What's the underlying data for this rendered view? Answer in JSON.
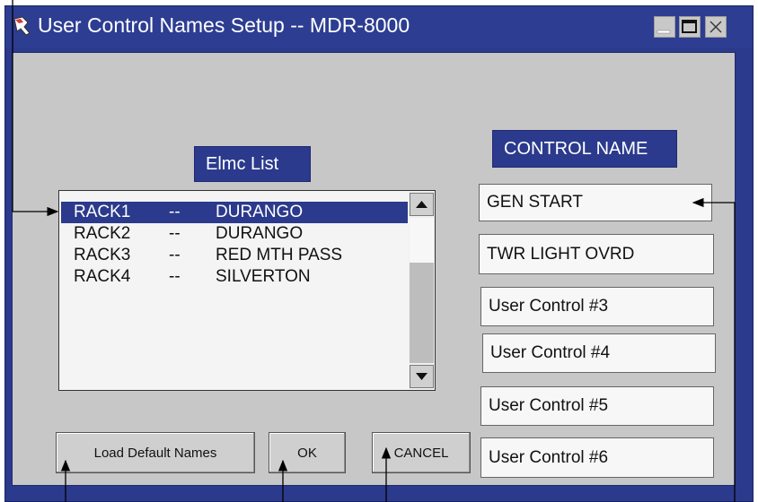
{
  "window": {
    "title": "User Control Names Setup  --  MDR-8000",
    "app_icon": "app-icon",
    "buttons": [
      "minimize-icon",
      "maximize-icon",
      "close-icon"
    ]
  },
  "labels": {
    "elmc_list": "Elmc List",
    "control_name": "CONTROL NAME"
  },
  "list": {
    "rows": [
      {
        "rack": "RACK1",
        "sep": "--",
        "site": "DURANGO",
        "selected": true
      },
      {
        "rack": "RACK2",
        "sep": "--",
        "site": "DURANGO",
        "selected": false
      },
      {
        "rack": "RACK3",
        "sep": "--",
        "site": "RED MTH PASS",
        "selected": false
      },
      {
        "rack": "RACK4",
        "sep": "--",
        "site": "SILVERTON",
        "selected": false
      }
    ]
  },
  "controls": [
    "GEN START",
    "TWR LIGHT OVRD",
    "User Control #3",
    "User Control #4",
    "User Control #5",
    "User Control #6"
  ],
  "buttons": {
    "load_defaults": "Load Default Names",
    "ok": "OK",
    "cancel": "CANCEL"
  },
  "colors": {
    "window_blue": "#2b3a8c",
    "panel_gray": "#c7c7c7",
    "selection_blue": "#2b3a8c"
  }
}
